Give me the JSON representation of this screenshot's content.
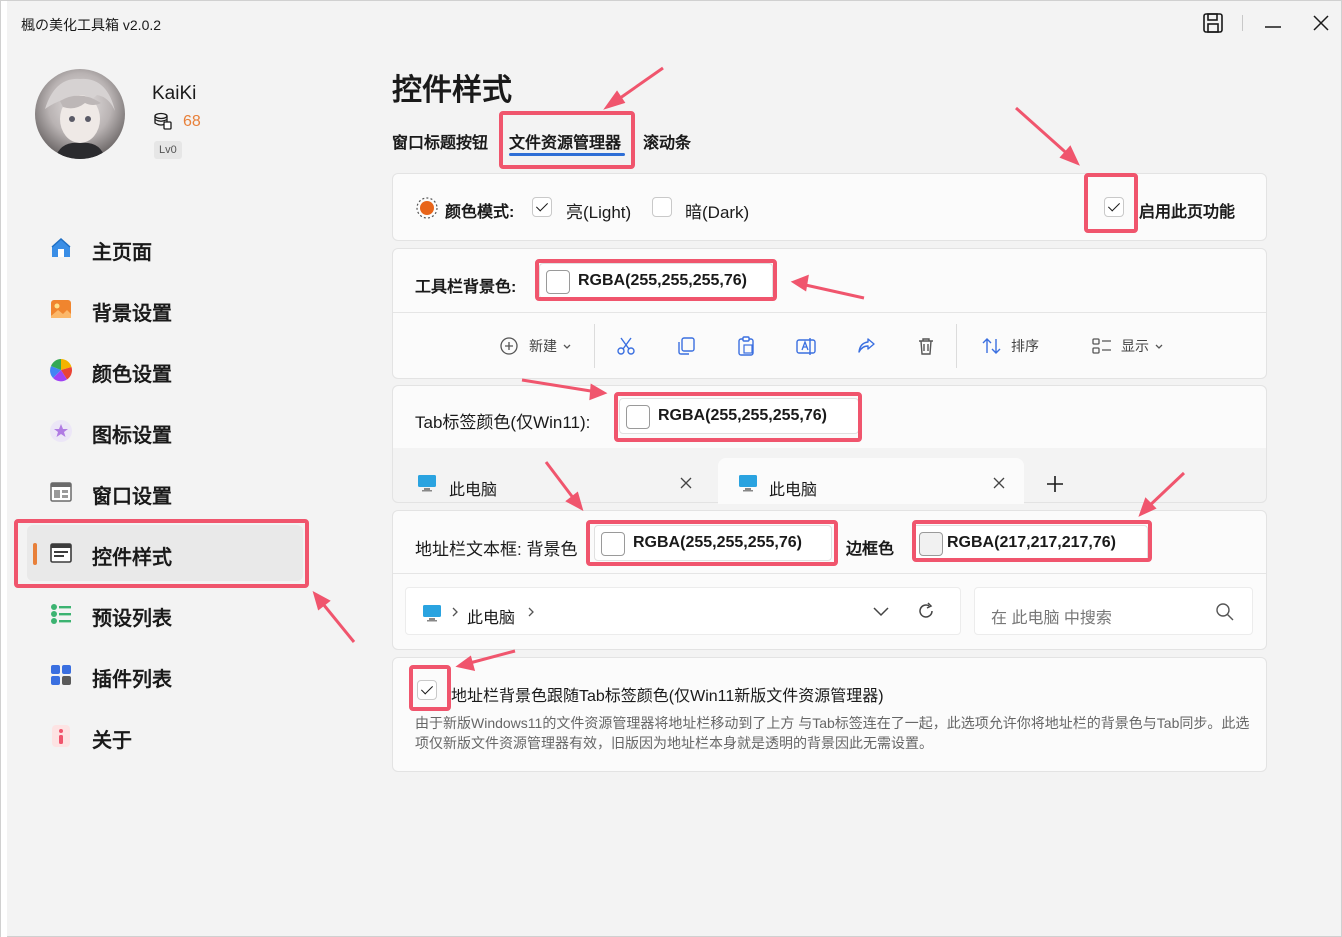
{
  "app": {
    "title": "楓の美化工具箱 v2.0.2"
  },
  "user": {
    "name": "KaiKi",
    "coins": "68",
    "level": "Lv0"
  },
  "sidebar": {
    "items": [
      {
        "label": "主页面",
        "icon": "home-icon"
      },
      {
        "label": "背景设置",
        "icon": "image-icon"
      },
      {
        "label": "颜色设置",
        "icon": "color-wheel-icon"
      },
      {
        "label": "图标设置",
        "icon": "star-icon"
      },
      {
        "label": "窗口设置",
        "icon": "window-icon"
      },
      {
        "label": "控件样式",
        "icon": "control-style-icon"
      },
      {
        "label": "预设列表",
        "icon": "list-icon"
      },
      {
        "label": "插件列表",
        "icon": "plugin-icon"
      },
      {
        "label": "关于",
        "icon": "info-icon"
      }
    ],
    "active_index": 5
  },
  "main": {
    "title": "控件样式",
    "tabs": [
      {
        "label": "窗口标题按钮"
      },
      {
        "label": "文件资源管理器"
      },
      {
        "label": "滚动条"
      }
    ],
    "active_tab": 1,
    "color_mode": {
      "label": "颜色模式:",
      "light_label": "亮(Light)",
      "dark_label": "暗(Dark)",
      "light_checked": true,
      "dark_checked": false
    },
    "enable_page": {
      "label": "启用此页功能",
      "checked": true
    },
    "toolbar_bg": {
      "label": "工具栏背景色:",
      "value": "RGBA(255,255,255,76)"
    },
    "toolbar_preview": {
      "new_label": "新建",
      "sort_label": "排序",
      "view_label": "显示"
    },
    "tab_color": {
      "label": "Tab标签颜色(仅Win11):",
      "value": "RGBA(255,255,255,76)"
    },
    "tab_preview": {
      "tabs": [
        {
          "label": "此电脑"
        },
        {
          "label": "此电脑"
        }
      ]
    },
    "address_bar": {
      "label": "地址栏文本框: 背景色",
      "bg_value": "RGBA(255,255,255,76)",
      "border_label": "边框色",
      "border_value": "RGBA(217,217,217,76)"
    },
    "address_preview": {
      "path": "此电脑",
      "search_placeholder": "在 此电脑 中搜索"
    },
    "follow_tab": {
      "label": "地址栏背景色跟随Tab标签颜色(仅Win11新版文件资源管理器)",
      "checked": true,
      "description": "由于新版Windows11的文件资源管理器将地址栏移动到了上方 与Tab标签连在了一起，此选项允许你将地址栏的背景色与Tab同步。此选项仅新版文件资源管理器有效，旧版因为地址栏本身就是透明的背景因此无需设置。"
    }
  },
  "colors": {
    "accent": "#e8803a",
    "tab_underline": "#2f6fd6",
    "highlight": "#f0556d"
  }
}
